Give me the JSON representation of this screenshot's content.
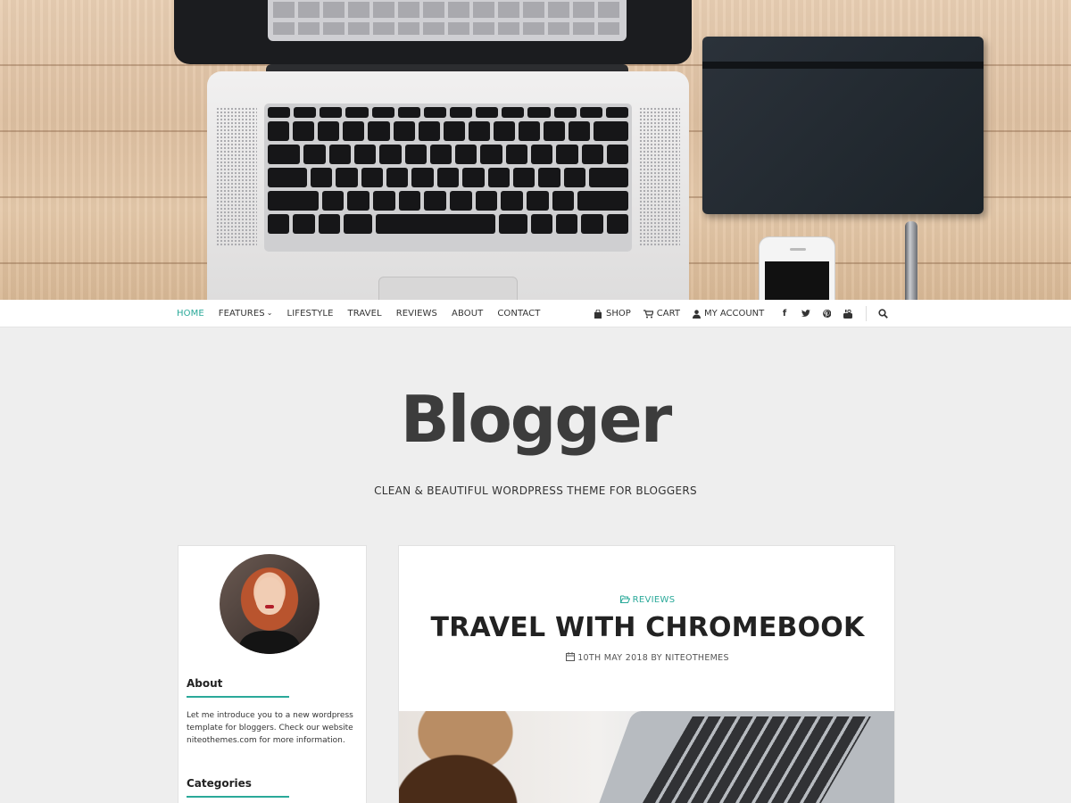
{
  "nav": {
    "menu": [
      {
        "label": "HOME",
        "active": true
      },
      {
        "label": "FEATURES",
        "active": false
      },
      {
        "label": "LIFESTYLE",
        "active": false
      },
      {
        "label": "TRAVEL",
        "active": false
      },
      {
        "label": "REVIEWS",
        "active": false
      },
      {
        "label": "ABOUT",
        "active": false
      },
      {
        "label": "CONTACT",
        "active": false
      }
    ],
    "shop": {
      "shop_label": "SHOP",
      "cart_label": "CART",
      "account_label": "MY ACCOUNT"
    },
    "social_icons": [
      "facebook-icon",
      "twitter-icon",
      "pinterest-icon",
      "youtube-icon"
    ],
    "accent_color": "#2aa999"
  },
  "site": {
    "title": "Blogger",
    "tagline": "CLEAN & BEAUTIFUL WORDPRESS THEME FOR BLOGGERS"
  },
  "sidebar": {
    "about_title": "About",
    "about_text": "Let me introduce you to a new wordpress template for bloggers. Check our website niteothemes.com for more information.",
    "categories_title": "Categories"
  },
  "post": {
    "category": "REVIEWS",
    "title": "TRAVEL WITH CHROMEBOOK",
    "meta": "10TH MAY 2018 BY NITEOTHEMES"
  }
}
